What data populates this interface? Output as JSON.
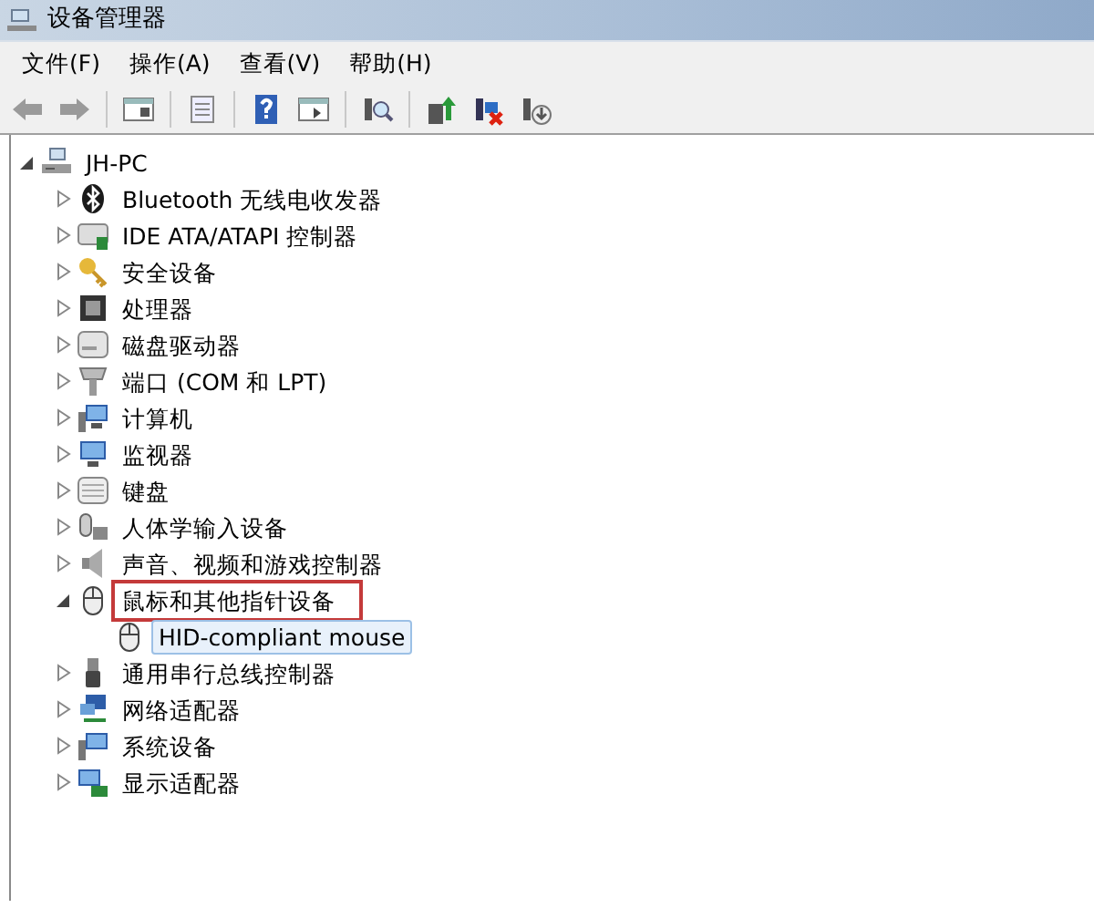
{
  "window": {
    "title": "设备管理器"
  },
  "menu": [
    "文件(F)",
    "操作(A)",
    "查看(V)",
    "帮助(H)"
  ],
  "tree": [
    {
      "label": "JH-PC",
      "expanded": true,
      "selected": false,
      "annotated": false,
      "children": [
        {
          "label": "Bluetooth 无线电收发器",
          "expanded": false,
          "selected": false,
          "annotated": false
        },
        {
          "label": "IDE ATA/ATAPI 控制器",
          "expanded": false,
          "selected": false,
          "annotated": false
        },
        {
          "label": "安全设备",
          "expanded": false,
          "selected": false,
          "annotated": false
        },
        {
          "label": "处理器",
          "expanded": false,
          "selected": false,
          "annotated": false
        },
        {
          "label": "磁盘驱动器",
          "expanded": false,
          "selected": false,
          "annotated": false
        },
        {
          "label": "端口 (COM 和 LPT)",
          "expanded": false,
          "selected": false,
          "annotated": false
        },
        {
          "label": "计算机",
          "expanded": false,
          "selected": false,
          "annotated": false
        },
        {
          "label": "监视器",
          "expanded": false,
          "selected": false,
          "annotated": false
        },
        {
          "label": "键盘",
          "expanded": false,
          "selected": false,
          "annotated": false
        },
        {
          "label": "人体学输入设备",
          "expanded": false,
          "selected": false,
          "annotated": false
        },
        {
          "label": "声音、视频和游戏控制器",
          "expanded": false,
          "selected": false,
          "annotated": false
        },
        {
          "label": "鼠标和其他指针设备",
          "expanded": true,
          "selected": false,
          "annotated": true,
          "children": [
            {
              "label": "HID-compliant mouse",
              "selected": true,
              "annotated": false
            }
          ]
        },
        {
          "label": "通用串行总线控制器",
          "expanded": false,
          "selected": false,
          "annotated": false
        },
        {
          "label": "网络适配器",
          "expanded": false,
          "selected": false,
          "annotated": false
        },
        {
          "label": "系统设备",
          "expanded": false,
          "selected": false,
          "annotated": false
        },
        {
          "label": "显示适配器",
          "expanded": false,
          "selected": false,
          "annotated": false
        }
      ]
    }
  ]
}
